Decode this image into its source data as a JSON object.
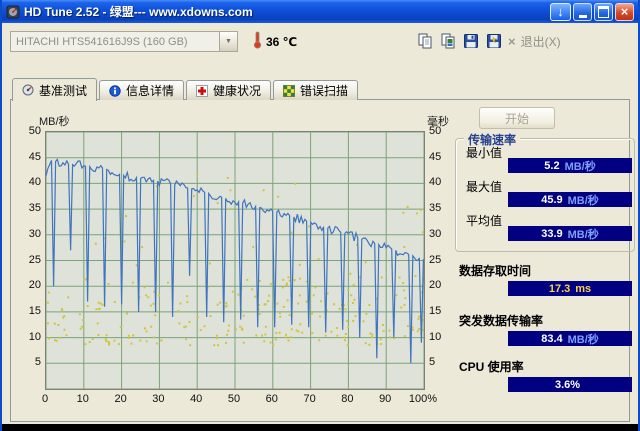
{
  "window": {
    "title": "HD Tune 2.52 - 绿盟--- www.xdowns.com"
  },
  "toolbar": {
    "drive_select": "HITACHI HTS541616J9S (160 GB)",
    "temperature": "36 ℃",
    "exit_label": "退出(X)"
  },
  "tabs": [
    {
      "id": "benchmark",
      "label": "基准测试",
      "active": true
    },
    {
      "id": "info",
      "label": "信息详情",
      "active": false
    },
    {
      "id": "health",
      "label": "健康状况",
      "active": false
    },
    {
      "id": "error-scan",
      "label": "错误扫描",
      "active": false
    }
  ],
  "panel": {
    "start_button": "开始",
    "transfer_group": {
      "title": "传输速率",
      "items": [
        {
          "label": "最小值",
          "value": "5.2",
          "unit": "MB/秒"
        },
        {
          "label": "最大值",
          "value": "45.9",
          "unit": "MB/秒"
        },
        {
          "label": "平均值",
          "value": "33.9",
          "unit": "MB/秒"
        }
      ]
    },
    "sections": [
      {
        "label": "数据存取时间",
        "value": "17.3",
        "unit": "ms"
      },
      {
        "label": "突发数据传输率",
        "value": "83.4",
        "unit": "MB/秒"
      },
      {
        "label": "CPU 使用率",
        "value": "3.6%",
        "unit": ""
      }
    ]
  },
  "chart_data": {
    "type": "line+scatter",
    "y_left_label": "MB/秒",
    "y_right_label": "毫秒",
    "y_ticks": [
      50,
      45,
      40,
      35,
      30,
      25,
      20,
      15,
      10,
      5
    ],
    "x_ticks": [
      "0",
      "10",
      "20",
      "30",
      "40",
      "50",
      "60",
      "70",
      "80",
      "90",
      "100%"
    ],
    "y_range": [
      0,
      50
    ],
    "x_range": [
      0,
      100
    ],
    "grid_step_x": 10,
    "grid_step_y": 5,
    "line_color": "#3f74bf",
    "dot_color": "#d2c53a",
    "grid_color": "#7aa37a",
    "plot_bg": "#dfe2d8",
    "transfer_line_base": [
      [
        0,
        41.5
      ],
      [
        0.8,
        44.6
      ],
      [
        5,
        43.8
      ],
      [
        10,
        43.4
      ],
      [
        15,
        43.0
      ],
      [
        20,
        41.6
      ],
      [
        25,
        41.0
      ],
      [
        30,
        40.4
      ],
      [
        35,
        39.5
      ],
      [
        40,
        38.7
      ],
      [
        45,
        37.6
      ],
      [
        50,
        36.6
      ],
      [
        55,
        35.6
      ],
      [
        60,
        34.6
      ],
      [
        65,
        33.6
      ],
      [
        70,
        32.4
      ],
      [
        75,
        31.2
      ],
      [
        80,
        30.0
      ],
      [
        85,
        28.8
      ],
      [
        90,
        27.6
      ],
      [
        95,
        26.4
      ],
      [
        100,
        25.2
      ]
    ],
    "transfer_dips": [
      [
        2,
        20
      ],
      [
        6.5,
        27
      ],
      [
        11,
        17
      ],
      [
        15.5,
        16
      ],
      [
        20,
        16.5
      ],
      [
        24.5,
        15
      ],
      [
        29,
        15
      ],
      [
        33.5,
        14
      ],
      [
        38,
        22
      ],
      [
        42.5,
        14
      ],
      [
        47,
        13
      ],
      [
        51.5,
        13.5
      ],
      [
        56,
        12
      ],
      [
        60.5,
        12
      ],
      [
        65,
        12.5
      ],
      [
        69.5,
        12
      ],
      [
        74,
        11
      ],
      [
        78.5,
        11.5
      ],
      [
        83,
        10
      ],
      [
        87.5,
        6
      ],
      [
        92,
        10
      ],
      [
        96.5,
        5
      ],
      [
        99.3,
        9
      ]
    ],
    "noise_amplitude": 0.9,
    "access_dots": {
      "seed": 20110413,
      "band_count": 235,
      "band_y": [
        8.5,
        22
      ],
      "outlier_count": 32,
      "outlier_y": [
        22,
        43
      ]
    },
    "summary": {
      "min_mbs": 5.2,
      "max_mbs": 45.9,
      "avg_mbs": 33.9,
      "access_time_ms": 17.3,
      "burst_rate_mbs": 83.4,
      "cpu_usage_pct": 3.6
    }
  },
  "colors": {
    "badge_bg": "#000080",
    "badge_value": "#ffffff",
    "badge_unit": "#7f9fff",
    "badge_access_value": "#ffd24a",
    "titlebar_gradient_top": "#4a8cf7",
    "titlebar_gradient_bottom": "#0a41bd",
    "window_bg": "#ece9d8"
  }
}
